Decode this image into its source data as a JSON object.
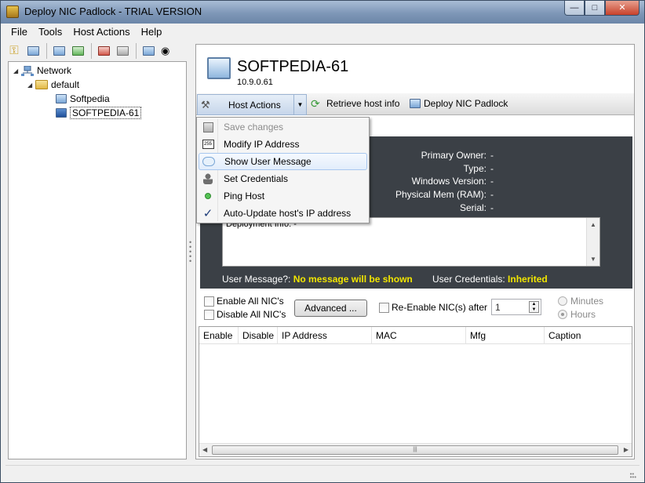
{
  "window": {
    "title": "Deploy NIC Padlock - TRIAL VERSION"
  },
  "menu": [
    "File",
    "Tools",
    "Host Actions",
    "Help"
  ],
  "toolbar": {
    "icons": [
      "key-icon",
      "add-host-icon",
      "add-group-icon",
      "add-network-icon",
      "remove-host-icon",
      "edit-host-icon",
      "scan-icon",
      "binoculars-icon"
    ]
  },
  "tree": {
    "root": "Network",
    "group": "default",
    "hosts": [
      "Softpedia",
      "SOFTPEDIA-61"
    ]
  },
  "host": {
    "name": "SOFTPEDIA-61",
    "ip": "10.9.0.61"
  },
  "actionbar": {
    "host_actions": "Host Actions",
    "retrieve": "Retrieve host info",
    "deploy": "Deploy NIC Padlock"
  },
  "dropdown": {
    "items": [
      {
        "label": "Save changes",
        "icon": "floppy-icon"
      },
      {
        "label": "Modify IP Address",
        "icon": "ip-icon"
      },
      {
        "label": "Show User Message",
        "icon": "message-icon"
      },
      {
        "label": "Set Credentials",
        "icon": "user-icon"
      },
      {
        "label": "Ping Host",
        "icon": "green-dot-icon"
      },
      {
        "label": "Auto-Update host's IP address",
        "icon": "checkmark-icon"
      }
    ]
  },
  "info": {
    "fields": [
      {
        "label": "Primary Owner:",
        "value": "-"
      },
      {
        "label": "Type:",
        "value": "-"
      },
      {
        "label": "Windows Version:",
        "value": "-"
      },
      {
        "label": "Physical Mem (RAM):",
        "value": "-"
      },
      {
        "label": "Serial:",
        "value": "-"
      }
    ],
    "deployment_label": "Deployment Info:",
    "deployment_value": "-",
    "user_message_label": "User Message?:",
    "user_message_value": "No message will be shown",
    "credentials_label": "User Credentials:",
    "credentials_value": "Inherited"
  },
  "controls": {
    "enable_all": "Enable All NIC's",
    "disable_all": "Disable All NIC's",
    "advanced": "Advanced ...",
    "reenable": "Re-Enable NIC(s) after",
    "reenable_value": "1",
    "minutes": "Minutes",
    "hours": "Hours"
  },
  "grid": {
    "columns": [
      "Enable",
      "Disable",
      "IP Address",
      "MAC",
      "Mfg",
      "Caption"
    ]
  },
  "colors": {
    "info_panel_bg": "#3b4046",
    "highlight_text": "#f2e600",
    "titlebar": "#7e97b7"
  }
}
